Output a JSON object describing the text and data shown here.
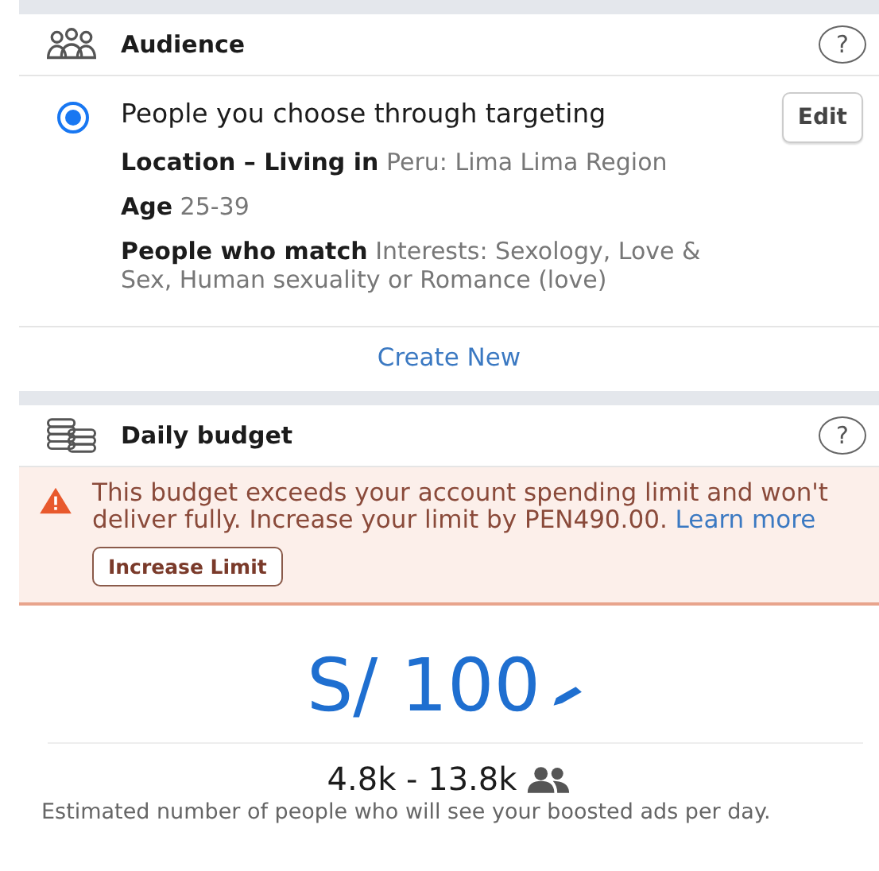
{
  "audience": {
    "title": "Audience",
    "help": "?",
    "option": {
      "label": "People you choose through targeting",
      "selected": true,
      "edit": "Edit",
      "details": [
        "**Location – Living in** Peru: Lima Lima Region",
        "**Age** 25-39",
        "**People who match** Interests: Sexology, Love & Sex, Human sexuality or Romance (love)"
      ]
    },
    "create_new": "Create New"
  },
  "budget": {
    "title": "Daily budget",
    "help": "?",
    "warning": {
      "text": "This budget exceeds your account spending limit and won't deliver fully. Increase your limit by PEN490.00.",
      "link": "Learn more",
      "button": "Increase Limit"
    },
    "amount": "S/ 100",
    "reach": "4.8k - 13.8k",
    "caption": "Estimated number of people who will see your boosted ads per day."
  }
}
